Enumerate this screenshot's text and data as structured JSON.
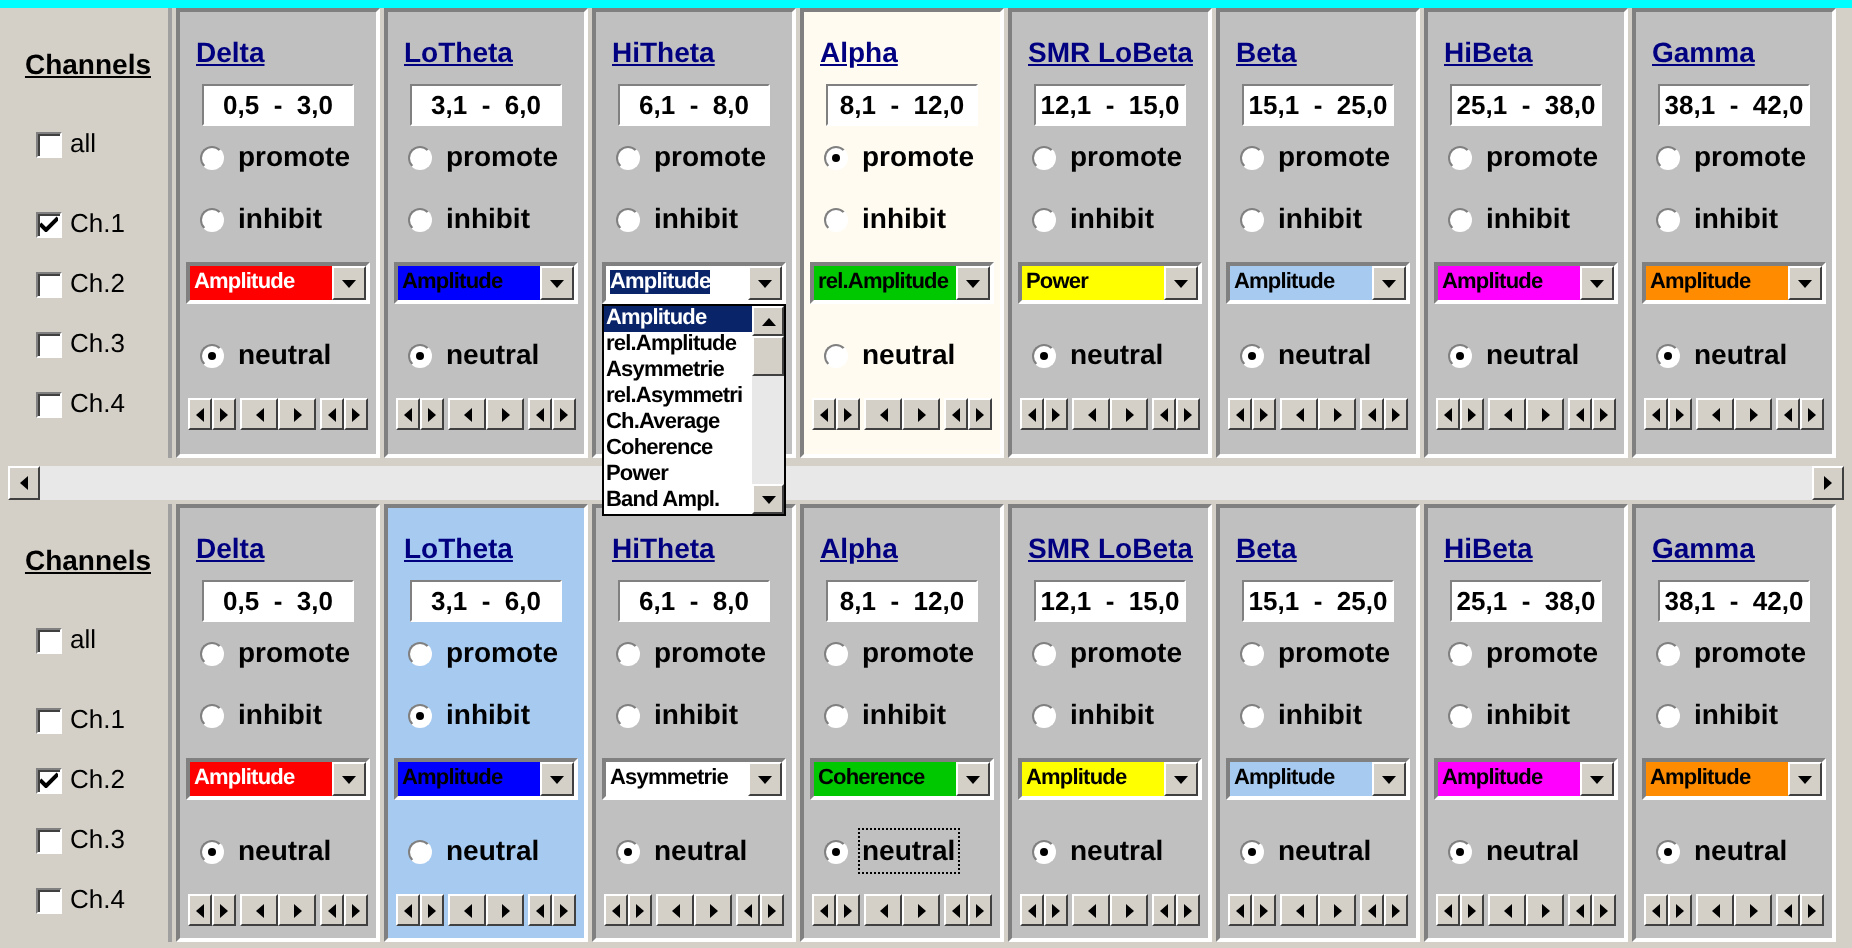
{
  "panels": [
    {
      "channels": {
        "title": "Channels",
        "items": [
          {
            "label": "all",
            "checked": false
          },
          {
            "label": "Ch.1",
            "checked": true
          },
          {
            "label": "Ch.2",
            "checked": false
          },
          {
            "label": "Ch.3",
            "checked": false
          },
          {
            "label": "Ch.4",
            "checked": false
          }
        ]
      },
      "bands": [
        {
          "name": "Delta",
          "range": "0,5  -  3,0",
          "highlighted": false,
          "promote": {
            "label": "promote",
            "selected": false
          },
          "inhibit": {
            "label": "inhibit",
            "selected": false
          },
          "measure": {
            "value": "Amplitude",
            "color": "#ff0000",
            "light_text": true,
            "focused": false
          },
          "neutral": {
            "label": "neutral",
            "selected": true,
            "focused": false
          }
        },
        {
          "name": "LoTheta",
          "range": "3,1  -  6,0",
          "highlighted": false,
          "promote": {
            "label": "promote",
            "selected": false
          },
          "inhibit": {
            "label": "inhibit",
            "selected": false
          },
          "measure": {
            "value": "Amplitude",
            "color": "#0000ff",
            "light_text": false,
            "focused": false
          },
          "neutral": {
            "label": "neutral",
            "selected": true,
            "focused": false
          }
        },
        {
          "name": "HiTheta",
          "range": "6,1  -  8,0",
          "highlighted": false,
          "promote": {
            "label": "promote",
            "selected": false
          },
          "inhibit": {
            "label": "inhibit",
            "selected": false
          },
          "measure": {
            "value": "Amplitude",
            "color": "#ffffff",
            "light_text": false,
            "focused": true,
            "open_list": [
              {
                "label": "Amplitude",
                "selected": true
              },
              {
                "label": "rel.Amplitude",
                "selected": false
              },
              {
                "label": "Asymmetrie",
                "selected": false
              },
              {
                "label": "rel.Asymmetri",
                "selected": false
              },
              {
                "label": "Ch.Average",
                "selected": false
              },
              {
                "label": "Coherence",
                "selected": false
              },
              {
                "label": "Power",
                "selected": false
              },
              {
                "label": "Band Ampl.",
                "selected": false
              }
            ]
          }
        },
        {
          "name": "Alpha",
          "range": "8,1  -  12,0",
          "highlighted": true,
          "promote": {
            "label": "promote",
            "selected": true
          },
          "inhibit": {
            "label": "inhibit",
            "selected": false
          },
          "measure": {
            "value": "rel.Amplitude",
            "color": "#00c800",
            "light_text": false,
            "focused": false
          },
          "neutral": {
            "label": "neutral",
            "selected": false,
            "focused": false
          }
        },
        {
          "name": "SMR LoBeta",
          "range": "12,1  -  15,0",
          "highlighted": false,
          "promote": {
            "label": "promote",
            "selected": false
          },
          "inhibit": {
            "label": "inhibit",
            "selected": false
          },
          "measure": {
            "value": "Power",
            "color": "#ffff00",
            "light_text": false,
            "focused": false
          },
          "neutral": {
            "label": "neutral",
            "selected": true,
            "focused": false
          }
        },
        {
          "name": "Beta",
          "range": "15,1  -  25,0",
          "highlighted": false,
          "promote": {
            "label": "promote",
            "selected": false
          },
          "inhibit": {
            "label": "inhibit",
            "selected": false
          },
          "measure": {
            "value": "Amplitude",
            "color": "#a6caf0",
            "light_text": false,
            "focused": false
          },
          "neutral": {
            "label": "neutral",
            "selected": true,
            "focused": false
          }
        },
        {
          "name": "HiBeta",
          "range": "25,1  -  38,0",
          "highlighted": false,
          "promote": {
            "label": "promote",
            "selected": false
          },
          "inhibit": {
            "label": "inhibit",
            "selected": false
          },
          "measure": {
            "value": "Amplitude",
            "color": "#ff00ff",
            "light_text": false,
            "focused": false
          },
          "neutral": {
            "label": "neutral",
            "selected": true,
            "focused": false
          }
        },
        {
          "name": "Gamma",
          "range": "38,1  -  42,0",
          "highlighted": false,
          "promote": {
            "label": "promote",
            "selected": false
          },
          "inhibit": {
            "label": "inhibit",
            "selected": false
          },
          "measure": {
            "value": "Amplitude",
            "color": "#ff8c00",
            "light_text": false,
            "focused": false
          },
          "neutral": {
            "label": "neutral",
            "selected": true,
            "focused": false
          }
        }
      ]
    },
    {
      "channels": {
        "title": "Channels",
        "items": [
          {
            "label": "all",
            "checked": false
          },
          {
            "label": "Ch.1",
            "checked": false
          },
          {
            "label": "Ch.2",
            "checked": true
          },
          {
            "label": "Ch.3",
            "checked": false
          },
          {
            "label": "Ch.4",
            "checked": false
          }
        ]
      },
      "bands": [
        {
          "name": "Delta",
          "range": "0,5  -  3,0",
          "highlighted": false,
          "promote": {
            "label": "promote",
            "selected": false
          },
          "inhibit": {
            "label": "inhibit",
            "selected": false
          },
          "measure": {
            "value": "Amplitude",
            "color": "#ff0000",
            "light_text": true,
            "focused": false
          },
          "neutral": {
            "label": "neutral",
            "selected": true,
            "focused": false
          }
        },
        {
          "name": "LoTheta",
          "range": "3,1  -  6,0",
          "highlighted": true,
          "promote": {
            "label": "promote",
            "selected": false
          },
          "inhibit": {
            "label": "inhibit",
            "selected": true
          },
          "measure": {
            "value": "Amplitude",
            "color": "#0000ff",
            "light_text": false,
            "focused": false
          },
          "neutral": {
            "label": "neutral",
            "selected": false,
            "focused": false
          }
        },
        {
          "name": "HiTheta",
          "range": "6,1  -  8,0",
          "highlighted": false,
          "promote": {
            "label": "promote",
            "selected": false
          },
          "inhibit": {
            "label": "inhibit",
            "selected": false
          },
          "measure": {
            "value": "Asymmetrie",
            "color": "#ffffff",
            "light_text": false,
            "focused": false
          },
          "neutral": {
            "label": "neutral",
            "selected": true,
            "focused": false
          }
        },
        {
          "name": "Alpha",
          "range": "8,1  -  12,0",
          "highlighted": false,
          "promote": {
            "label": "promote",
            "selected": false
          },
          "inhibit": {
            "label": "inhibit",
            "selected": false
          },
          "measure": {
            "value": "Coherence",
            "color": "#00c800",
            "light_text": false,
            "focused": false
          },
          "neutral": {
            "label": "neutral",
            "selected": true,
            "focused": true
          }
        },
        {
          "name": "SMR LoBeta",
          "range": "12,1  -  15,0",
          "highlighted": false,
          "promote": {
            "label": "promote",
            "selected": false
          },
          "inhibit": {
            "label": "inhibit",
            "selected": false
          },
          "measure": {
            "value": "Amplitude",
            "color": "#ffff00",
            "light_text": false,
            "focused": false
          },
          "neutral": {
            "label": "neutral",
            "selected": true,
            "focused": false
          }
        },
        {
          "name": "Beta",
          "range": "15,1  -  25,0",
          "highlighted": false,
          "promote": {
            "label": "promote",
            "selected": false
          },
          "inhibit": {
            "label": "inhibit",
            "selected": false
          },
          "measure": {
            "value": "Amplitude",
            "color": "#a6caf0",
            "light_text": false,
            "focused": false
          },
          "neutral": {
            "label": "neutral",
            "selected": true,
            "focused": false
          }
        },
        {
          "name": "HiBeta",
          "range": "25,1  -  38,0",
          "highlighted": false,
          "promote": {
            "label": "promote",
            "selected": false
          },
          "inhibit": {
            "label": "inhibit",
            "selected": false
          },
          "measure": {
            "value": "Amplitude",
            "color": "#ff00ff",
            "light_text": false,
            "focused": false
          },
          "neutral": {
            "label": "neutral",
            "selected": true,
            "focused": false
          }
        },
        {
          "name": "Gamma",
          "range": "38,1  -  42,0",
          "highlighted": false,
          "promote": {
            "label": "promote",
            "selected": false
          },
          "inhibit": {
            "label": "inhibit",
            "selected": false
          },
          "measure": {
            "value": "Amplitude",
            "color": "#ff8c00",
            "light_text": false,
            "focused": false
          },
          "neutral": {
            "label": "neutral",
            "selected": true,
            "focused": false
          }
        }
      ]
    }
  ]
}
